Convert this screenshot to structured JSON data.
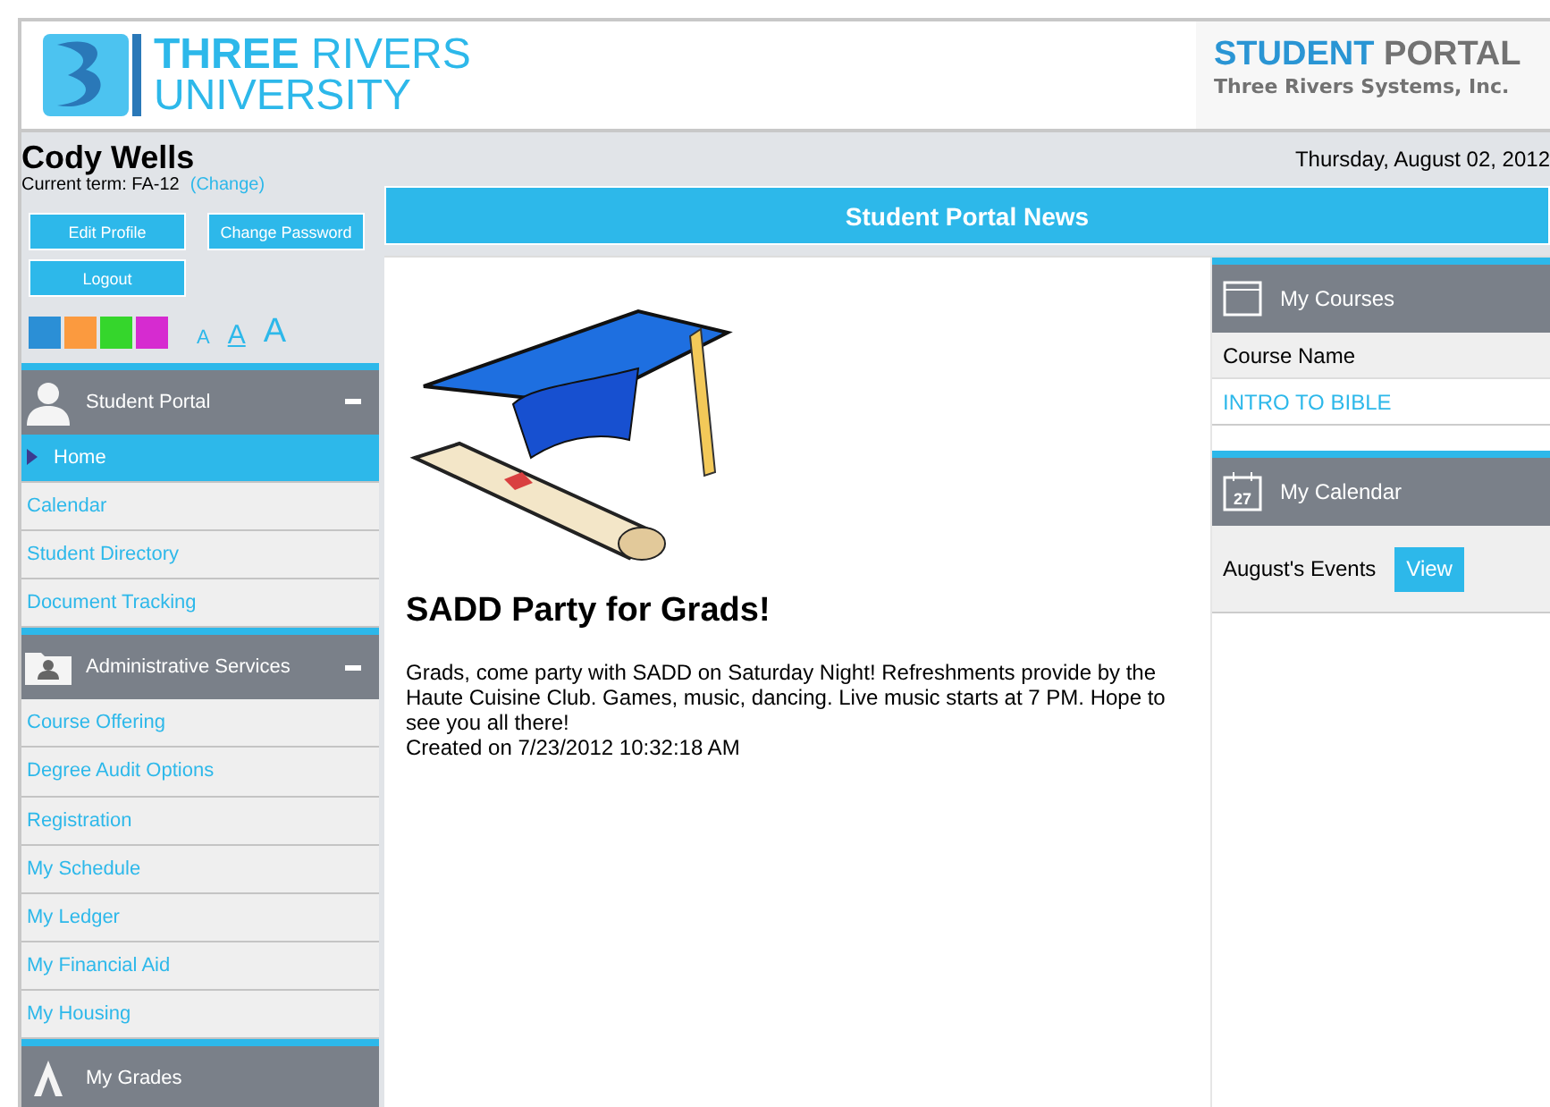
{
  "header": {
    "logo_word_1": "THREE",
    "logo_word_2": "RIVERS",
    "logo_word_3": "UNIVERSITY",
    "portal_word_1": "STUDENT",
    "portal_word_2": "PORTAL",
    "portal_subtitle": "Three Rivers Systems, Inc."
  },
  "user": {
    "name": "Cody Wells",
    "term_label": "Current term: FA-12",
    "change_link": "(Change)",
    "date": "Thursday, August 02, 2012"
  },
  "account_buttons": [
    "Edit Profile",
    "Change Password",
    "Logout"
  ],
  "themes": [
    {
      "color": "#2b8fd6",
      "selected": false
    },
    {
      "color": "#fb9a3f",
      "selected": false
    },
    {
      "color": "#35d62c",
      "selected": false
    },
    {
      "color": "#d62bd0",
      "selected": false
    }
  ],
  "font_sizes": [
    {
      "label": "A",
      "kind": "small",
      "selected": false
    },
    {
      "label": "A",
      "kind": "medium",
      "selected": true
    },
    {
      "label": "A",
      "kind": "large",
      "selected": false
    }
  ],
  "sidebar": {
    "groups": [
      {
        "title": "Student Portal",
        "kind": "person",
        "expanded": true,
        "items": [
          {
            "label": "Home",
            "selected": true
          },
          {
            "label": "Calendar",
            "selected": false
          },
          {
            "label": "Student Directory",
            "selected": false
          },
          {
            "label": "Document Tracking",
            "selected": false
          }
        ]
      },
      {
        "title": "Administrative Services",
        "kind": "folder",
        "expanded": true,
        "items": [
          {
            "label": "Course Offering",
            "selected": false
          },
          {
            "label": "Degree Audit Options",
            "selected": false
          },
          {
            "label": "Registration",
            "selected": false
          },
          {
            "label": "My Schedule",
            "selected": false
          },
          {
            "label": "My Ledger",
            "selected": false
          },
          {
            "label": "My Financial Aid",
            "selected": false
          },
          {
            "label": "My Housing",
            "selected": false
          }
        ]
      },
      {
        "title": "My Grades",
        "kind": "grades",
        "expanded": false
      }
    ]
  },
  "news": {
    "title": "Student Portal News",
    "headline": "SADD Party for Grads!",
    "body": "Grads, come party with SADD on Saturday Night! Refreshments provide by the Haute Cuisine Club. Games, music, dancing. Live music starts at 7 PM. Hope to see you all there!",
    "created": "Created on 7/23/2012 10:32:18 AM"
  },
  "my_courses": {
    "title": "My Courses",
    "column": "Course Name",
    "courses": [
      "INTRO TO BIBLE"
    ]
  },
  "my_calendar": {
    "title": "My Calendar",
    "day": "27",
    "events_label": "August's Events",
    "view_button": "View"
  }
}
